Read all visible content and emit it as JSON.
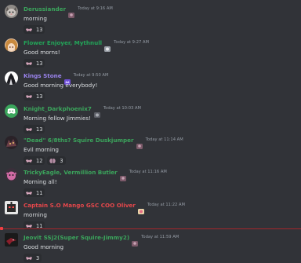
{
  "messages": [
    {
      "author": "Derussiander",
      "author_color": "#3ba55c",
      "badge_icon": "trophy-icon",
      "timestamp": "Today at 9:16 AM",
      "content": "morning",
      "avatar": "grey-cat-avatar",
      "reactions": [
        {
          "icon": "bat-emoji",
          "count": "13"
        }
      ]
    },
    {
      "author": "Flower Enjoyer, Mythnull",
      "author_color": "#23a559",
      "badge_icon": "cat-icon",
      "timestamp": "Today at 9:27 AM",
      "content": "Good morns!",
      "avatar": "anime-girl-avatar",
      "reactions": [
        {
          "icon": "bat-emoji",
          "count": "13"
        }
      ]
    },
    {
      "author": "Kings Stone",
      "author_color": "#9b84ee",
      "badge_icon": "crown-icon",
      "timestamp": "Today at 9:50 AM",
      "content": "Good morning everybody!",
      "avatar": "white-anime-avatar",
      "reactions": [
        {
          "icon": "bat-emoji",
          "count": "13"
        }
      ]
    },
    {
      "author": "Knight_Darkphoenix7",
      "author_color": "#3ba55c",
      "badge_icon": "cat-icon",
      "timestamp": "Today at 10:03 AM",
      "content": "Morning fellow Jimmies!",
      "avatar": "discord-default-avatar",
      "reactions": [
        {
          "icon": "bat-emoji",
          "count": "13"
        }
      ]
    },
    {
      "author": "\"Dead\" 6/8ths? Squire Duskjumper",
      "author_color": "#3ba55c",
      "badge_icon": "trophy-icon",
      "timestamp": "Today at 11:14 AM",
      "content": "Evil morning",
      "avatar": "dark-creature-avatar",
      "reactions": [
        {
          "icon": "bat-emoji",
          "count": "12"
        },
        {
          "icon": "moth-emoji",
          "count": "3"
        }
      ]
    },
    {
      "author": "TrickyEagle, Vermillion Butler",
      "author_color": "#3ba55c",
      "badge_icon": "trophy-icon",
      "timestamp": "Today at 11:16 AM",
      "content": "Morning all!",
      "avatar": "pink-creature-avatar",
      "reactions": [
        {
          "icon": "bat-emoji",
          "count": "11"
        }
      ]
    },
    {
      "author": "Captain S.O Mango GSC COO Oliver",
      "author_color": "#e5474b",
      "badge_icon": "flower-icon",
      "timestamp": "Today at 11:22 AM",
      "content": "morning",
      "avatar": "robot-avatar",
      "reactions": [
        {
          "icon": "bat-emoji",
          "count": "11"
        }
      ]
    },
    {
      "author": "Jeovit SSj2(Super Squire-Jimmy2)",
      "author_color": "#3ba55c",
      "badge_icon": "trophy-icon",
      "timestamp": "Today at 11:59 AM",
      "content": "Good morning",
      "avatar": "dark-bird-avatar",
      "reactions": [
        {
          "icon": "bat-emoji",
          "count": "3"
        }
      ]
    }
  ],
  "colors": {
    "background": "#313338",
    "text": "#dbdee1",
    "timestamp": "#949ba4",
    "new_divider": "#f23f43",
    "reaction_bg": "#2b2d31"
  }
}
